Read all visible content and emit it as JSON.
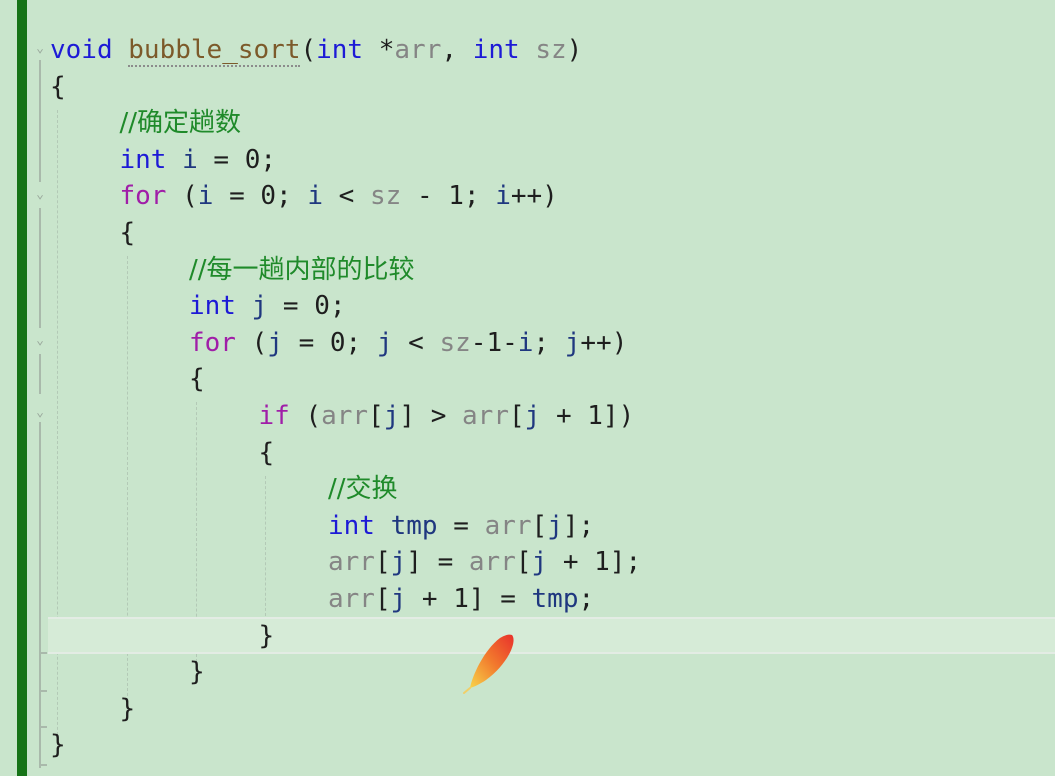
{
  "editor": {
    "language": "C",
    "current_line": 17,
    "lines": [
      {
        "num": 1,
        "indent": 0,
        "tokens": [
          {
            "t": "void",
            "c": "kw"
          },
          {
            "t": " "
          },
          {
            "t": "bubble_sort",
            "c": "fn"
          },
          {
            "t": "("
          },
          {
            "t": "int",
            "c": "kw"
          },
          {
            "t": " *"
          },
          {
            "t": "arr",
            "c": "param"
          },
          {
            "t": ", "
          },
          {
            "t": "int",
            "c": "kw"
          },
          {
            "t": " "
          },
          {
            "t": "sz",
            "c": "param"
          },
          {
            "t": ")"
          }
        ]
      },
      {
        "num": 2,
        "indent": 0,
        "tokens": [
          {
            "t": "{"
          }
        ]
      },
      {
        "num": 3,
        "indent": 1,
        "tokens": [
          {
            "t": "//确定趟数",
            "c": "cmt"
          }
        ]
      },
      {
        "num": 4,
        "indent": 1,
        "tokens": [
          {
            "t": "int",
            "c": "kw"
          },
          {
            "t": " "
          },
          {
            "t": "i",
            "c": "var"
          },
          {
            "t": " = 0;"
          }
        ]
      },
      {
        "num": 5,
        "indent": 1,
        "tokens": [
          {
            "t": "for",
            "c": "ctl"
          },
          {
            "t": " ("
          },
          {
            "t": "i",
            "c": "var"
          },
          {
            "t": " = 0; "
          },
          {
            "t": "i",
            "c": "var"
          },
          {
            "t": " < "
          },
          {
            "t": "sz",
            "c": "param"
          },
          {
            "t": " - 1; "
          },
          {
            "t": "i",
            "c": "var"
          },
          {
            "t": "++)"
          }
        ]
      },
      {
        "num": 6,
        "indent": 1,
        "tokens": [
          {
            "t": "{"
          }
        ]
      },
      {
        "num": 7,
        "indent": 2,
        "tokens": [
          {
            "t": "//每一趟内部的比较",
            "c": "cmt"
          }
        ]
      },
      {
        "num": 8,
        "indent": 2,
        "tokens": [
          {
            "t": "int",
            "c": "kw"
          },
          {
            "t": " "
          },
          {
            "t": "j",
            "c": "var"
          },
          {
            "t": " = 0;"
          }
        ]
      },
      {
        "num": 9,
        "indent": 2,
        "tokens": [
          {
            "t": "for",
            "c": "ctl"
          },
          {
            "t": " ("
          },
          {
            "t": "j",
            "c": "var"
          },
          {
            "t": " = 0; "
          },
          {
            "t": "j",
            "c": "var"
          },
          {
            "t": " < "
          },
          {
            "t": "sz",
            "c": "param"
          },
          {
            "t": "-1-"
          },
          {
            "t": "i",
            "c": "var"
          },
          {
            "t": "; "
          },
          {
            "t": "j",
            "c": "var"
          },
          {
            "t": "++)"
          }
        ]
      },
      {
        "num": 10,
        "indent": 2,
        "tokens": [
          {
            "t": "{"
          }
        ]
      },
      {
        "num": 11,
        "indent": 3,
        "tokens": [
          {
            "t": "if",
            "c": "ctl"
          },
          {
            "t": " ("
          },
          {
            "t": "arr",
            "c": "param"
          },
          {
            "t": "["
          },
          {
            "t": "j",
            "c": "var"
          },
          {
            "t": "] > "
          },
          {
            "t": "arr",
            "c": "param"
          },
          {
            "t": "["
          },
          {
            "t": "j",
            "c": "var"
          },
          {
            "t": " + 1])"
          }
        ]
      },
      {
        "num": 12,
        "indent": 3,
        "tokens": [
          {
            "t": "{"
          }
        ]
      },
      {
        "num": 13,
        "indent": 4,
        "tokens": [
          {
            "t": "//交换",
            "c": "cmt"
          }
        ]
      },
      {
        "num": 14,
        "indent": 4,
        "tokens": [
          {
            "t": "int",
            "c": "kw"
          },
          {
            "t": " "
          },
          {
            "t": "tmp",
            "c": "var"
          },
          {
            "t": " = "
          },
          {
            "t": "arr",
            "c": "param"
          },
          {
            "t": "["
          },
          {
            "t": "j",
            "c": "var"
          },
          {
            "t": "];"
          }
        ]
      },
      {
        "num": 15,
        "indent": 4,
        "tokens": [
          {
            "t": "arr",
            "c": "param"
          },
          {
            "t": "["
          },
          {
            "t": "j",
            "c": "var"
          },
          {
            "t": "] = "
          },
          {
            "t": "arr",
            "c": "param"
          },
          {
            "t": "["
          },
          {
            "t": "j",
            "c": "var"
          },
          {
            "t": " + 1];"
          }
        ]
      },
      {
        "num": 16,
        "indent": 4,
        "tokens": [
          {
            "t": "arr",
            "c": "param"
          },
          {
            "t": "["
          },
          {
            "t": "j",
            "c": "var"
          },
          {
            "t": " + 1] = "
          },
          {
            "t": "tmp",
            "c": "var"
          },
          {
            "t": ";"
          }
        ]
      },
      {
        "num": 17,
        "indent": 3,
        "tokens": [
          {
            "t": "}"
          }
        ]
      },
      {
        "num": 18,
        "indent": 2,
        "tokens": [
          {
            "t": "}"
          }
        ]
      },
      {
        "num": 19,
        "indent": 1,
        "tokens": [
          {
            "t": "}"
          }
        ]
      },
      {
        "num": 20,
        "indent": 0,
        "tokens": [
          {
            "t": "}"
          }
        ]
      }
    ],
    "fold_markers": [
      1,
      5,
      9,
      11
    ],
    "colors": {
      "background": "#c9e5cc",
      "change_bar": "#167317",
      "keyword": "#1d1ad6",
      "control": "#a01ea8",
      "function": "#7c5a2a",
      "parameter": "#858585",
      "variable": "#1f377f",
      "comment": "#1f8a2a"
    }
  },
  "overlay": {
    "icon": "feather-icon"
  }
}
